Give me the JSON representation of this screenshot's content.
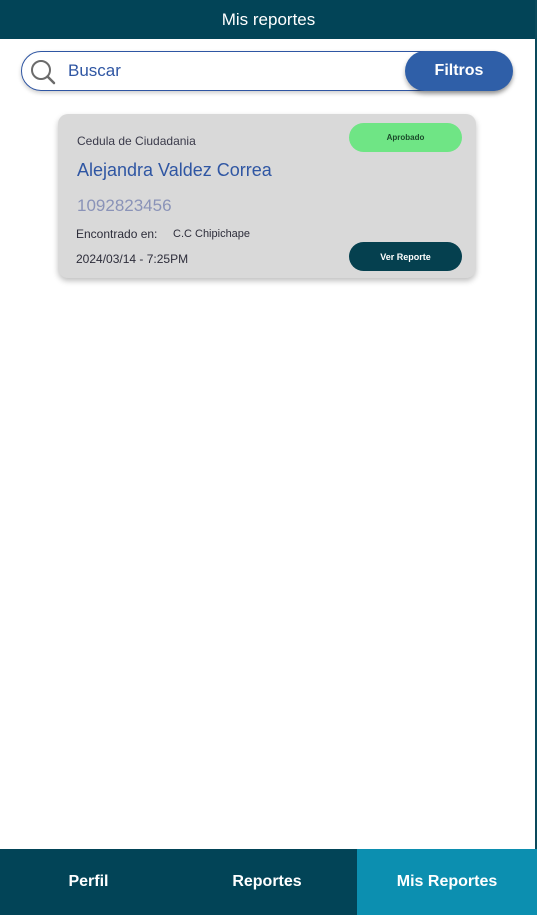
{
  "header": {
    "title": "Mis reportes"
  },
  "search": {
    "placeholder": "Buscar",
    "value": ""
  },
  "filters": {
    "label": "Filtros"
  },
  "reports": [
    {
      "doc_type": "Cedula de Ciudadania",
      "status": "Aprobado",
      "name": "Alejandra Valdez Correa",
      "doc_number": "1092823456",
      "found_label": "Encontrado en:",
      "found_location": "C.C Chipichape",
      "date": "2024/03/14 - 7:25PM",
      "action_label": "Ver Reporte"
    }
  ],
  "nav": {
    "items": [
      {
        "label": "Perfil",
        "active": false
      },
      {
        "label": "Reportes",
        "active": false
      },
      {
        "label": "Mis Reportes",
        "active": true
      }
    ]
  },
  "colors": {
    "primary": "#024457",
    "accent": "#2f5fa8",
    "active_tab": "#0c8fb0",
    "approved": "#6fe585",
    "card": "#d9d9d9"
  },
  "icons": {
    "search": "search-icon"
  }
}
